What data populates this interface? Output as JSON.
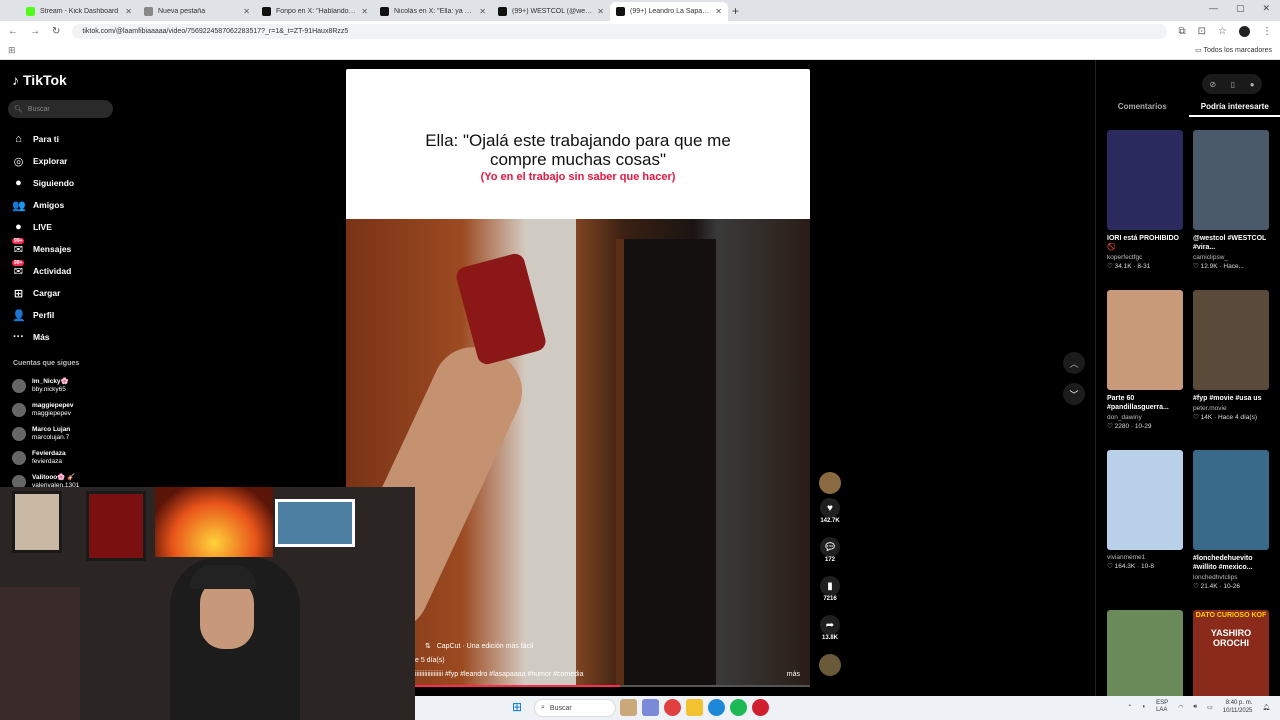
{
  "browser": {
    "tabs": [
      {
        "title": "Stream - Kick Dashboard",
        "color": "#53fc18",
        "active": false
      },
      {
        "title": "Nueva pestaña",
        "color": "#888888",
        "active": false
      },
      {
        "title": "Fonpo en X: \"Hablando claro lo...",
        "color": "#111111",
        "active": false
      },
      {
        "title": "Nicolás en X: \"Ella: ya entró? Yo...",
        "color": "#111111",
        "active": false
      },
      {
        "title": "(99+) WESTCOL (@westcol) oficial",
        "color": "#111111",
        "active": false
      },
      {
        "title": "(99+) Leandro La Sapaaaa | Ti...",
        "color": "#111111",
        "active": true
      }
    ],
    "url": "tiktok.com/@laamfibiaaaaa/video/7569224587062283517?_r=1&_t=ZT-91Haux8Rzz5",
    "bookmarks_label": "Todos los marcadores"
  },
  "sidebar": {
    "logo": "TikTok",
    "search_placeholder": "Buscar",
    "nav": [
      {
        "label": "Para ti",
        "icon": "home-icon",
        "glyph": "⌂"
      },
      {
        "label": "Explorar",
        "icon": "compass-icon",
        "glyph": "◎"
      },
      {
        "label": "Siguiendo",
        "icon": "following-icon",
        "glyph": "●"
      },
      {
        "label": "Amigos",
        "icon": "friends-icon",
        "glyph": "👥"
      },
      {
        "label": "LIVE",
        "icon": "live-icon",
        "glyph": "●"
      },
      {
        "label": "Mensajes",
        "icon": "messages-icon",
        "glyph": "✉",
        "badge": "99+"
      },
      {
        "label": "Actividad",
        "icon": "activity-icon",
        "glyph": "✉",
        "badge": "99+"
      },
      {
        "label": "Cargar",
        "icon": "upload-icon",
        "glyph": "⊞"
      },
      {
        "label": "Perfil",
        "icon": "profile-icon",
        "glyph": "👤"
      },
      {
        "label": "Más",
        "icon": "more-icon",
        "glyph": "···"
      }
    ],
    "following_title": "Cuentas que sigues",
    "following": [
      {
        "name": "Im_Nicky🌸",
        "handle": "bby.nicky65"
      },
      {
        "name": "maggiepepev",
        "handle": "maggiepepev"
      },
      {
        "name": "Marco Lujan",
        "handle": "marcolujan.7"
      },
      {
        "name": "Fevierdaza",
        "handle": "fevierdaza"
      },
      {
        "name": "Valitooo🌸 🎸",
        "handle": "valenvalen.1301"
      }
    ]
  },
  "video": {
    "caption_line1": "Ella: \"Ojalá este trabajando para que me",
    "caption_line2": "compre muchas cosas\"",
    "caption_sub": "(Yo en el trabajo sin saber que hacer)",
    "capcut": "CapCut · Una edición más fácil",
    "time_ago": "e 5 día(s)",
    "hashtags": "iiiiiiiiiiiiiiiiii #fyp #leandro #lasapaaaa #humor #comedia",
    "more": "más",
    "progress": 0.52
  },
  "actions": {
    "likes": "142.7K",
    "comments": "172",
    "saves": "7216",
    "shares": "13.8K"
  },
  "right_panel": {
    "tab_comments": "Comentarios",
    "tab_interest": "Podría interesarte",
    "cards": [
      {
        "title": "IORI está PROHIBIDO 🚫",
        "user": "koperfectfgc",
        "stats": "♡ 34.1K · 8-31",
        "color": "#2a2a5e"
      },
      {
        "title": "@westcol #WESTCOL #vira...",
        "user": "camiclipsw_",
        "stats": "♡ 12.9K · Hace...",
        "color": "#4a5a6a"
      },
      {
        "title": "Parte 60 #pandillasguerra...",
        "user": "don_dawiny",
        "stats": "♡ 2280 · 10-29",
        "color": "#c89a7a"
      },
      {
        "title": "#fyp #movie #usa us",
        "user": "peter.movie",
        "stats": "♡ 14K · Hace 4 día(s)",
        "color": "#5a4a3a"
      },
      {
        "title": "",
        "user": "vivianmeme1",
        "stats": "♡ 164.3K · 10-8",
        "color": "#b8d0e8"
      },
      {
        "title": "#lonchedehuevito #willito #mexico...",
        "user": "lonchedhvtclips",
        "stats": "♡ 21.4K · 10-26",
        "color": "#3a6a8a"
      },
      {
        "title": "",
        "user": "",
        "stats": "",
        "color": "#6a8a5a"
      },
      {
        "title": "",
        "user": "",
        "stats": "",
        "color": "#8a2a1a"
      }
    ],
    "card6_overlay": "DATO CURIOSO KOF",
    "card6_overlay2": "YASHIRO OROCHI"
  },
  "taskbar": {
    "search_label": "Buscar",
    "lang": "ESP\nLAA",
    "time": "8:40 p. m.",
    "date": "10/11/2025"
  }
}
